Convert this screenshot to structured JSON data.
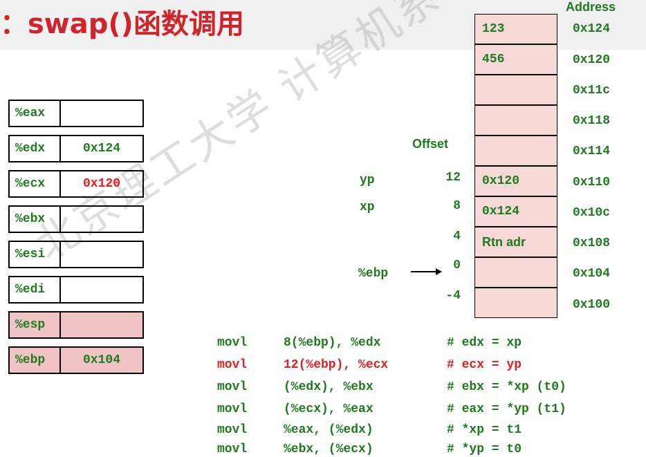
{
  "title": "：swap()函数调用",
  "watermark": "北京理工大学 计算机系 高天",
  "colors": {
    "accent": "#d0242b",
    "text_green": "#1e7a1e",
    "highlight_red": "#e02020",
    "cell_pink": "#f6d8d6",
    "reg_pink": "#f0c4c4"
  },
  "registers": [
    {
      "name": "%eax",
      "value": "",
      "highlight": false,
      "pink": false
    },
    {
      "name": "%edx",
      "value": "0x124",
      "highlight": false,
      "pink": false
    },
    {
      "name": "%ecx",
      "value": "0x120",
      "highlight": true,
      "pink": false
    },
    {
      "name": "%ebx",
      "value": "",
      "highlight": false,
      "pink": false
    },
    {
      "name": "%esi",
      "value": "",
      "highlight": false,
      "pink": false
    },
    {
      "name": "%edi",
      "value": "",
      "highlight": false,
      "pink": false
    },
    {
      "name": "%esp",
      "value": "",
      "highlight": false,
      "pink": true
    },
    {
      "name": "%ebp",
      "value": "0x104",
      "highlight": false,
      "pink": true
    }
  ],
  "memory": {
    "address_header": "Address",
    "offset_header": "Offset",
    "cells": [
      {
        "value": "123",
        "address": "0x124"
      },
      {
        "value": "456",
        "address": "0x120"
      },
      {
        "value": "",
        "address": "0x11c"
      },
      {
        "value": "",
        "address": "0x118"
      },
      {
        "value": "",
        "address": "0x114"
      },
      {
        "value": "0x120",
        "address": "0x110"
      },
      {
        "value": "0x124",
        "address": "0x10c"
      },
      {
        "value": "Rtn adr",
        "address": "0x108"
      },
      {
        "value": "",
        "address": "0x104"
      },
      {
        "value": "",
        "address": "0x100"
      }
    ],
    "offsets": [
      "12",
      "8",
      "4",
      "0",
      "-4"
    ],
    "labels": {
      "yp": "yp",
      "xp": "xp",
      "ebp": "%ebp"
    }
  },
  "code": [
    {
      "op": "movl",
      "args": "8(%ebp), %edx",
      "comment": "# edx = xp",
      "highlight": false
    },
    {
      "op": "movl",
      "args": "12(%ebp), %ecx",
      "comment": "# ecx = yp",
      "highlight": true
    },
    {
      "op": "movl",
      "args": "(%edx), %ebx",
      "comment": "# ebx = *xp (t0)",
      "highlight": false
    },
    {
      "op": "movl",
      "args": "(%ecx), %eax",
      "comment": "# eax = *yp (t1)",
      "highlight": false
    },
    {
      "op": "movl",
      "args": "%eax, (%edx)",
      "comment": "# *xp = t1",
      "highlight": false
    },
    {
      "op": "movl",
      "args": "%ebx, (%ecx)",
      "comment": "# *yp = t0",
      "highlight": false
    }
  ]
}
